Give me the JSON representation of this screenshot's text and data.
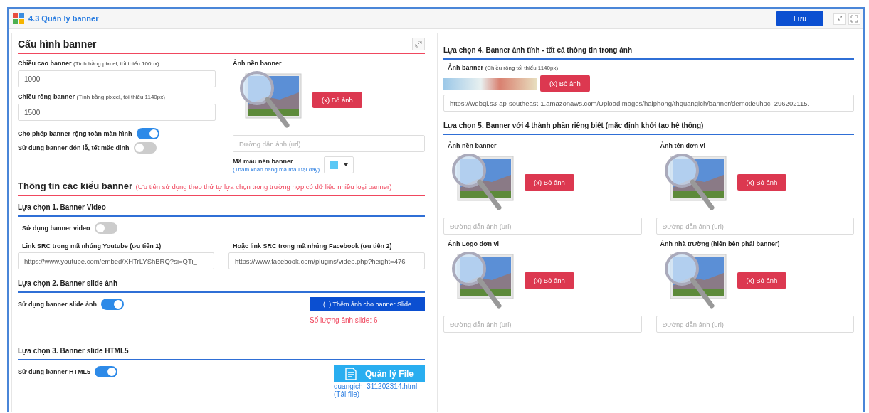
{
  "window": {
    "title": "4.3 Quản lý banner",
    "save_button": "Lưu"
  },
  "config": {
    "title": "Cấu hình banner",
    "fields": [
      {
        "label": "Chiều cao banner",
        "hint": "(Tính bằng pixcel, tối thiểu 100px)",
        "value": "1000"
      },
      {
        "label": "Chiều rộng banner",
        "hint": "(Tính bằng pixcel, tối thiểu 1140px)",
        "value": "1500"
      }
    ],
    "toggles": [
      {
        "label": "Cho phép banner rộng toàn màn hình",
        "on": true
      },
      {
        "label": "Sử dụng banner đón lễ, tết mặc định",
        "on": false
      }
    ],
    "background": {
      "label": "Ảnh nền banner",
      "remove_button": "(x) Bỏ ảnh",
      "url_placeholder": "Đường dẫn ảnh (url)"
    },
    "color": {
      "label": "Mã màu nền banner",
      "link": "(Tham khảo bảng mã màu tại đây)",
      "color": "#5bc8f5"
    }
  },
  "types": {
    "title": "Thông tin các kiểu banner",
    "note": "(Ưu tiên sử dụng theo thứ tự lựa chọn trong trường hợp có dữ liệu nhiều loại banner)"
  },
  "option1": {
    "title": "Lựa chọn 1. Banner Video",
    "toggle": {
      "label": "Sử dụng banner video",
      "on": false
    },
    "links": [
      {
        "label": "Link SRC trong mã nhúng Youtube (ưu tiên 1)",
        "value": "https://www.youtube.com/embed/XHTrLYShBRQ?si=QTi_"
      },
      {
        "label": "Hoặc link SRC trong mã nhúng Facebook (ưu tiên 2)",
        "value": "https://www.facebook.com/plugins/video.php?height=476"
      }
    ]
  },
  "option2": {
    "title": "Lựa chọn 2. Banner slide ảnh",
    "toggle": {
      "label": "Sử dụng banner slide ảnh",
      "on": true
    },
    "add_button": "(+) Thêm ảnh cho banner Slide",
    "count": "Số lượng ảnh slide: 6"
  },
  "option3": {
    "title": "Lựa chọn 3. Banner slide HTML5",
    "toggle": {
      "label": "Sử dụng banner HTML5",
      "on": true
    },
    "file_button": "Quản lý File",
    "file_link": "quangich_311202314.html",
    "download_link": "(Tải file)"
  },
  "option4": {
    "title": "Lựa chọn 4. Banner ảnh tĩnh - tất cả thông tin trong ảnh",
    "label": "Ảnh banner",
    "hint": "(Chiều rộng tối thiểu 1140px)",
    "remove_button": "(x) Bỏ ảnh",
    "url": "https://webqi.s3-ap-southeast-1.amazonaws.com/UploadImages/haiphong/thquangich/banner/demotieuhoc_296202115."
  },
  "option5": {
    "title": "Lựa chọn 5. Banner với 4 thành phần riêng biệt (mặc định khởi tạo hệ thống)",
    "images": [
      {
        "label": "Ảnh nền banner",
        "remove_button": "(x) Bỏ ảnh",
        "url_placeholder": "Đường dẫn ảnh (url)"
      },
      {
        "label": "Ảnh tên đơn vị",
        "remove_button": "(x) Bỏ ảnh",
        "url_placeholder": "Đường dẫn ảnh (url)"
      },
      {
        "label": "Ảnh Logo đơn vị",
        "remove_button": "(x) Bỏ ảnh",
        "url_placeholder": "Đường dẫn ảnh (url)"
      },
      {
        "label": "Ảnh nhà trường (hiện bên phải banner)",
        "remove_button": "(x) Bỏ ảnh",
        "url_placeholder": "Đường dẫn ảnh (url)"
      }
    ]
  }
}
